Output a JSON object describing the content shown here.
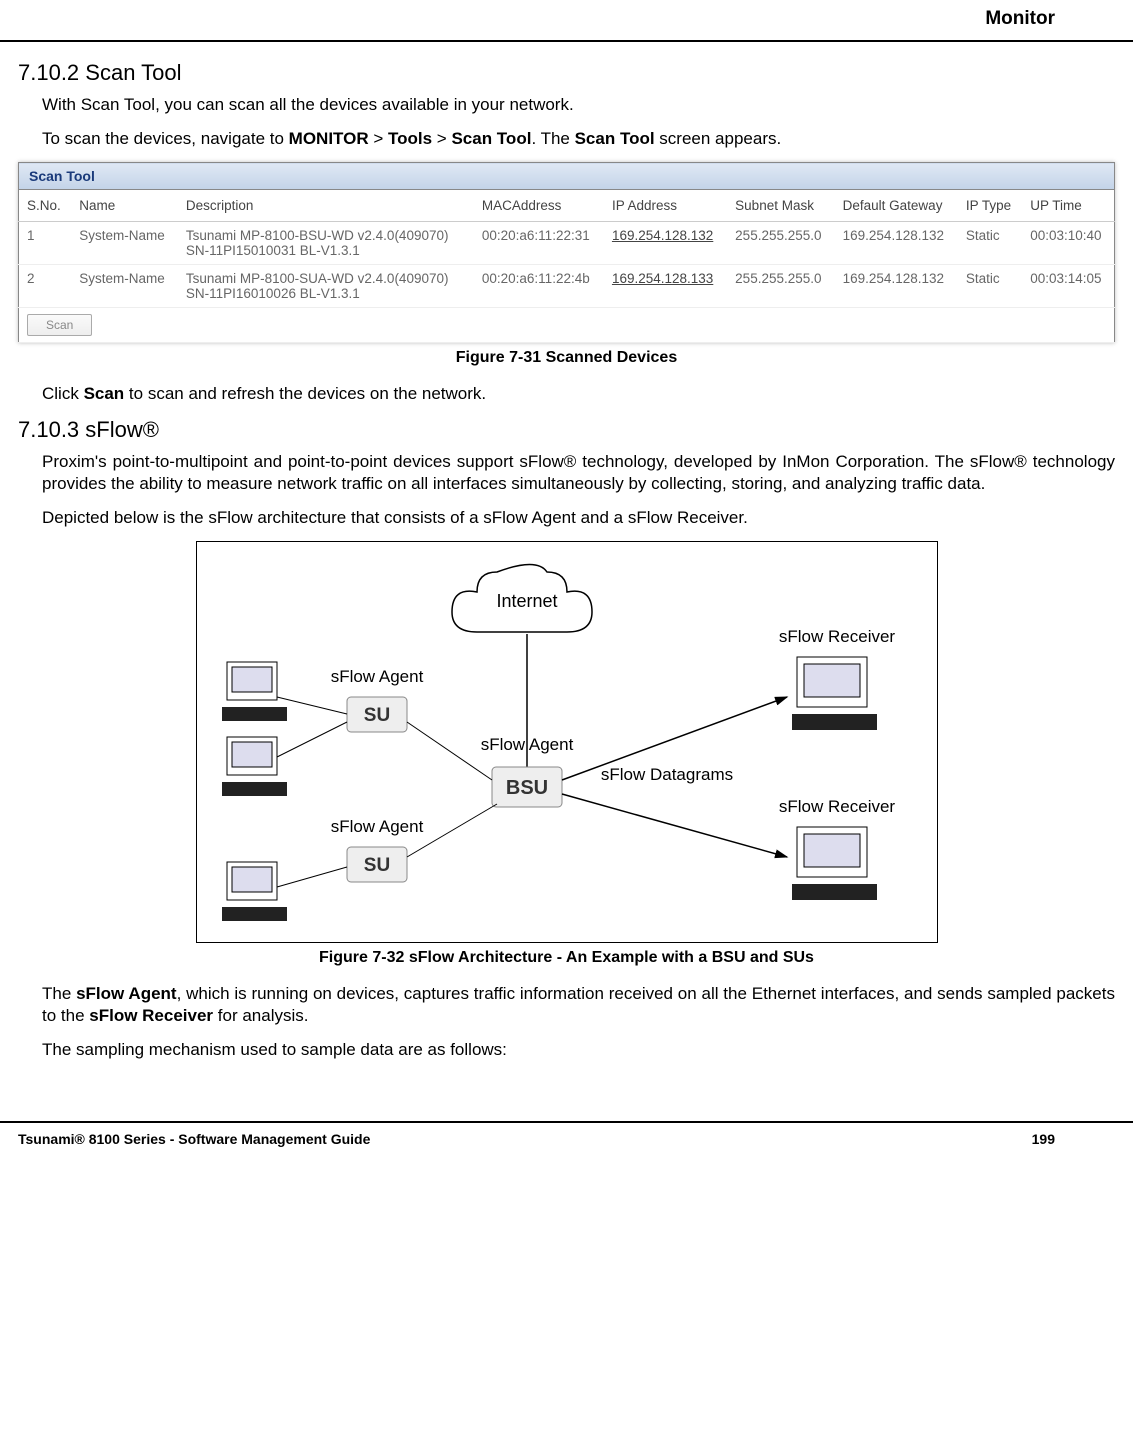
{
  "header": {
    "section": "Monitor"
  },
  "sections": {
    "scan_tool": {
      "number_title": "7.10.2 Scan Tool",
      "intro": "With Scan Tool, you can scan all the devices available in your network.",
      "nav_prefix": "To scan the devices, navigate to ",
      "nav_b1": "MONITOR",
      "nav_sep1": " > ",
      "nav_b2": "Tools",
      "nav_sep2": " > ",
      "nav_b3": "Scan Tool",
      "nav_mid": ". The ",
      "nav_b4": "Scan Tool",
      "nav_suffix": " screen appears.",
      "click_prefix": "Click ",
      "click_bold": "Scan",
      "click_suffix": " to scan and refresh the devices on the network."
    },
    "sflow": {
      "number_title": "7.10.3 sFlow®",
      "para1": "Proxim's point-to-multipoint and point-to-point devices support sFlow® technology, developed by InMon Corporation. The sFlow® technology provides the ability to measure network traffic on all interfaces simultaneously by collecting, storing, and analyzing traffic data.",
      "para2": "Depicted below is the sFlow architecture that consists of a sFlow Agent and a sFlow Receiver.",
      "after1_pre": "The ",
      "after1_b1": "sFlow Agent",
      "after1_mid": ", which is running on devices, captures traffic information received on all the Ethernet interfaces, and sends sampled packets to the ",
      "after1_b2": "sFlow Receiver",
      "after1_suf": " for analysis.",
      "after2": "The sampling mechanism used to sample data are as follows:"
    }
  },
  "scan_tool_screenshot": {
    "title": "Scan Tool",
    "headers": [
      "S.No.",
      "Name",
      "Description",
      "MACAddress",
      "IP Address",
      "Subnet Mask",
      "Default Gateway",
      "IP Type",
      "UP Time"
    ],
    "rows": [
      {
        "sno": "1",
        "name": "System-Name",
        "desc": "Tsunami MP-8100-BSU-WD v2.4.0(409070) SN-11PI15010031 BL-V1.3.1",
        "mac": "00:20:a6:11:22:31",
        "ip": "169.254.128.132",
        "mask": "255.255.255.0",
        "gw": "169.254.128.132",
        "iptype": "Static",
        "uptime": "00:03:10:40"
      },
      {
        "sno": "2",
        "name": "System-Name",
        "desc": "Tsunami MP-8100-SUA-WD v2.4.0(409070) SN-11PI16010026 BL-V1.3.1",
        "mac": "00:20:a6:11:22:4b",
        "ip": "169.254.128.133",
        "mask": "255.255.255.0",
        "gw": "169.254.128.132",
        "iptype": "Static",
        "uptime": "00:03:14:05"
      }
    ],
    "button": "Scan"
  },
  "figures": {
    "fig31": "Figure 7-31 Scanned Devices",
    "fig32": "Figure 7-32 sFlow Architecture - An Example with a BSU and SUs"
  },
  "diagram": {
    "internet": "Internet",
    "sflow_agent": "sFlow Agent",
    "sflow_receiver": "sFlow Receiver",
    "sflow_datagrams": "sFlow Datagrams",
    "su": "SU",
    "bsu": "BSU"
  },
  "footer": {
    "left": "Tsunami® 8100 Series - Software Management Guide",
    "right": "199"
  }
}
